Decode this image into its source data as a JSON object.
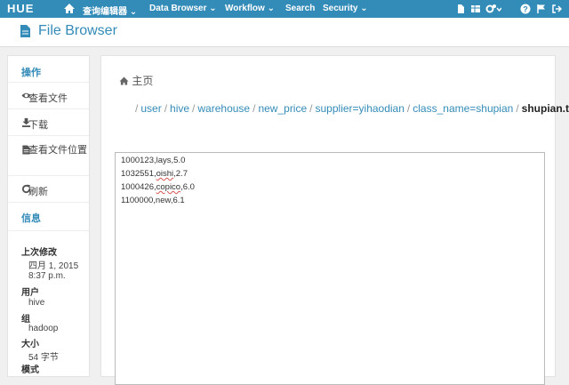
{
  "navbar": {
    "logo": "HUE",
    "menus": [
      {
        "label": "查询编辑器 ⌄"
      },
      {
        "label": "Data Browser ⌄"
      },
      {
        "label": "Workflow ⌄"
      },
      {
        "label": "Search"
      },
      {
        "label": "Security ⌄"
      }
    ]
  },
  "app": {
    "title": "File Browser"
  },
  "sidebar": {
    "actions_header": "操作",
    "actions": [
      {
        "label": "查看文件",
        "icon": "eye-icon"
      },
      {
        "label": "下载",
        "icon": "download-icon"
      },
      {
        "label": "查看文件位置",
        "icon": "file-location-icon"
      },
      {
        "label": "刷新",
        "icon": "refresh-icon"
      }
    ],
    "info_header": "信息",
    "info": {
      "modified_label": "上次修改",
      "modified_date": "四月 1, 2015",
      "modified_time": "8:37 p.m.",
      "user_label": "用户",
      "user_value": "hive",
      "group_label": "组",
      "group_value": "hadoop",
      "size_label": "大小",
      "size_value": "54 字节",
      "mode_label": "模式"
    }
  },
  "breadcrumb": {
    "home": "主页",
    "parts": [
      "user",
      "hive",
      "warehouse",
      "new_price",
      "supplier=yihaodian",
      "class_name=shupian"
    ],
    "current": "shupian.txt"
  },
  "file": {
    "lines": [
      {
        "a": "1000123,",
        "b": "lays",
        "c": ",5.0",
        "spell": false
      },
      {
        "a": "1032551,",
        "b": "oishi",
        "c": ",2.7",
        "spell": true
      },
      {
        "a": "1000426,",
        "b": "copico",
        "c": ",6.0",
        "spell": true
      },
      {
        "a": "1100000,",
        "b": "new",
        "c": ",6.1",
        "spell": false
      }
    ]
  },
  "colors": {
    "brand": "#338bb8",
    "navbar": "#338bb8"
  }
}
